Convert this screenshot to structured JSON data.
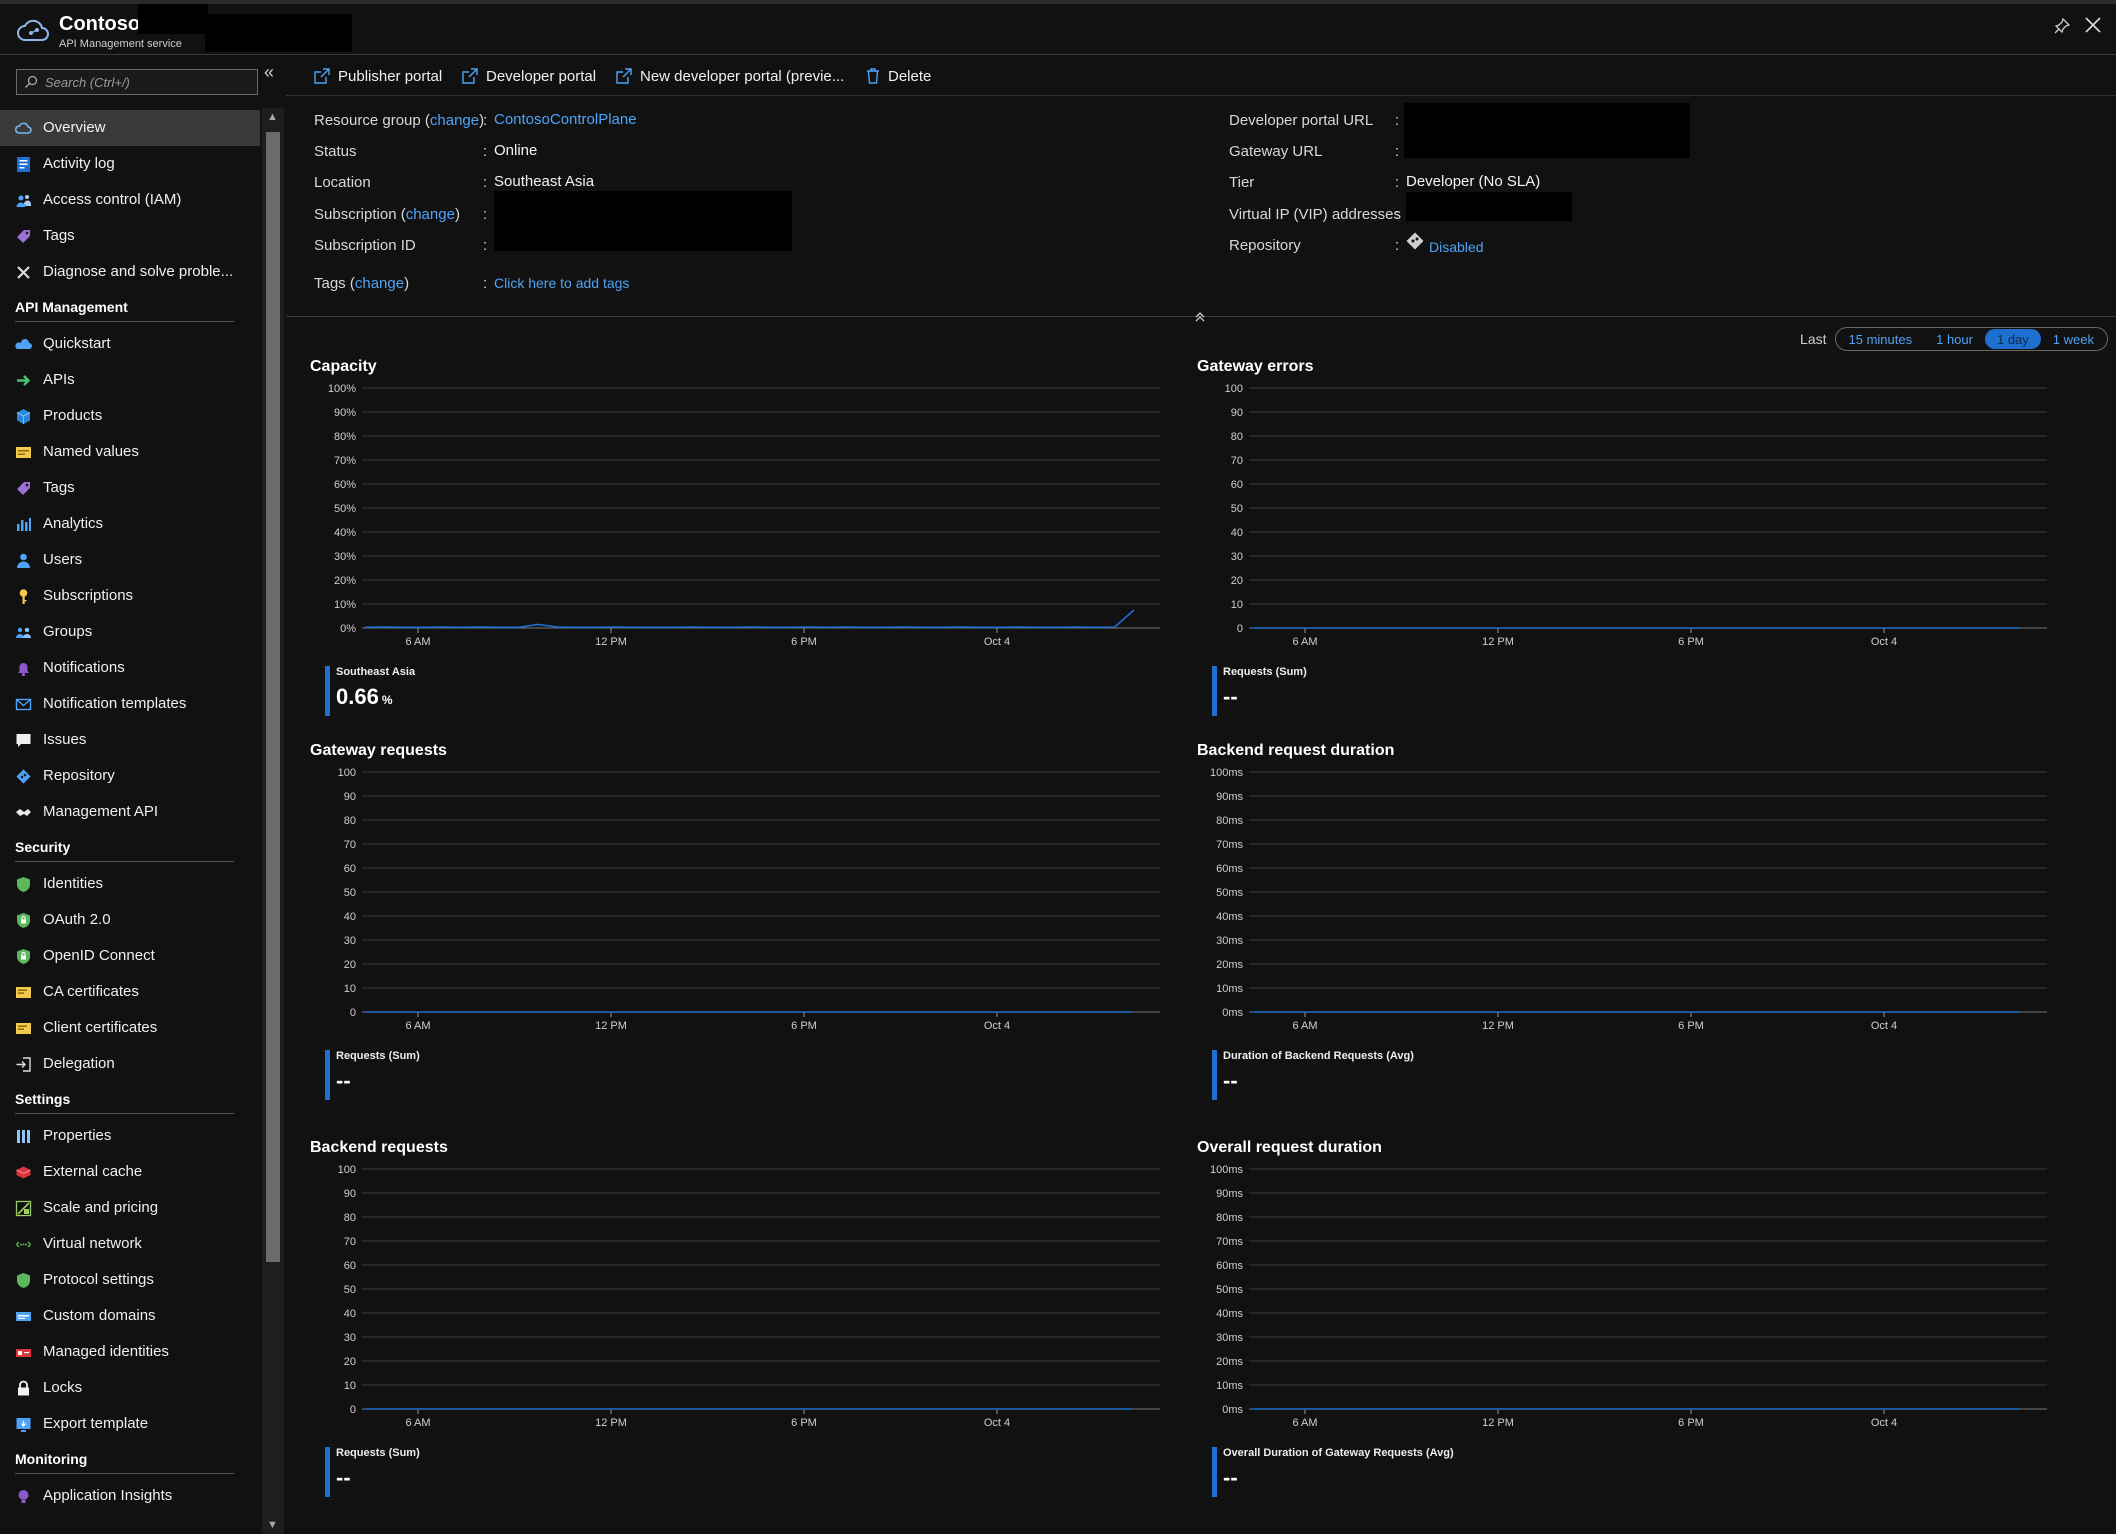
{
  "header": {
    "title": "Contoso",
    "subtitle": "API Management service"
  },
  "search": {
    "placeholder": "Search (Ctrl+/)"
  },
  "sidebar": {
    "collapse": "«",
    "entries": [
      {
        "kind": "item",
        "label": "Overview",
        "icon": "overview-cloud-icon",
        "active": true
      },
      {
        "kind": "item",
        "label": "Activity log",
        "icon": "activity-log-icon"
      },
      {
        "kind": "item",
        "label": "Access control (IAM)",
        "icon": "people-icon"
      },
      {
        "kind": "item",
        "label": "Tags",
        "icon": "tag-icon"
      },
      {
        "kind": "item",
        "label": "Diagnose and solve proble...",
        "icon": "wrench-icon"
      },
      {
        "kind": "section",
        "label": "API Management"
      },
      {
        "kind": "item",
        "label": "Quickstart",
        "icon": "cloud-icon"
      },
      {
        "kind": "item",
        "label": "APIs",
        "icon": "arrow-right-icon"
      },
      {
        "kind": "item",
        "label": "Products",
        "icon": "cube-icon"
      },
      {
        "kind": "item",
        "label": "Named values",
        "icon": "list-card-icon"
      },
      {
        "kind": "item",
        "label": "Tags",
        "icon": "tag-icon"
      },
      {
        "kind": "item",
        "label": "Analytics",
        "icon": "bar-chart-icon"
      },
      {
        "kind": "item",
        "label": "Users",
        "icon": "user-icon"
      },
      {
        "kind": "item",
        "label": "Subscriptions",
        "icon": "key-icon"
      },
      {
        "kind": "item",
        "label": "Groups",
        "icon": "group-icon"
      },
      {
        "kind": "item",
        "label": "Notifications",
        "icon": "bell-icon"
      },
      {
        "kind": "item",
        "label": "Notification templates",
        "icon": "mail-icon"
      },
      {
        "kind": "item",
        "label": "Issues",
        "icon": "chat-icon"
      },
      {
        "kind": "item",
        "label": "Repository",
        "icon": "repository-icon"
      },
      {
        "kind": "item",
        "label": "Management API",
        "icon": "handshake-icon"
      },
      {
        "kind": "section",
        "label": "Security"
      },
      {
        "kind": "item",
        "label": "Identities",
        "icon": "shield-icon"
      },
      {
        "kind": "item",
        "label": "OAuth 2.0",
        "icon": "shield-lock-icon"
      },
      {
        "kind": "item",
        "label": "OpenID Connect",
        "icon": "shield-lock-icon"
      },
      {
        "kind": "item",
        "label": "CA certificates",
        "icon": "certificate-icon"
      },
      {
        "kind": "item",
        "label": "Client certificates",
        "icon": "certificate-icon"
      },
      {
        "kind": "item",
        "label": "Delegation",
        "icon": "sign-in-icon"
      },
      {
        "kind": "section",
        "label": "Settings"
      },
      {
        "kind": "item",
        "label": "Properties",
        "icon": "properties-icon"
      },
      {
        "kind": "item",
        "label": "External cache",
        "icon": "cache-icon"
      },
      {
        "kind": "item",
        "label": "Scale and pricing",
        "icon": "scale-icon"
      },
      {
        "kind": "item",
        "label": "Virtual network",
        "icon": "network-icon"
      },
      {
        "kind": "item",
        "label": "Protocol settings",
        "icon": "shield-icon"
      },
      {
        "kind": "item",
        "label": "Custom domains",
        "icon": "domain-icon"
      },
      {
        "kind": "item",
        "label": "Managed identities",
        "icon": "identity-icon"
      },
      {
        "kind": "item",
        "label": "Locks",
        "icon": "lock-icon"
      },
      {
        "kind": "item",
        "label": "Export template",
        "icon": "export-icon"
      },
      {
        "kind": "section",
        "label": "Monitoring"
      },
      {
        "kind": "item",
        "label": "Application Insights",
        "icon": "insights-icon"
      }
    ]
  },
  "toolbar": {
    "publisher_portal": "Publisher portal",
    "developer_portal": "Developer portal",
    "new_developer_portal": "New developer portal (previe...",
    "delete": "Delete"
  },
  "essentials": {
    "resource_group_label": "Resource group",
    "change": "change",
    "resource_group_value": "ContosoControlPlane",
    "status_label": "Status",
    "status_value": "Online",
    "location_label": "Location",
    "location_value": "Southeast Asia",
    "subscription_label": "Subscription",
    "subscription_id_label": "Subscription ID",
    "tags_label": "Tags",
    "tags_value": "Click here to add tags",
    "dev_portal_url_label": "Developer portal URL",
    "gateway_url_label": "Gateway URL",
    "tier_label": "Tier",
    "tier_value": "Developer (No SLA)",
    "vip_label": "Virtual IP (VIP) addresses",
    "repository_label": "Repository",
    "repository_value": "Disabled",
    "colon": ":",
    "paren_open": "(",
    "paren_close": ")"
  },
  "time_range": {
    "last": "Last",
    "options": [
      "15 minutes",
      "1 hour",
      "1 day",
      "1 week"
    ],
    "selected": "1 day"
  },
  "chart_data": [
    {
      "type": "line",
      "title": "Capacity",
      "x_ticks": [
        "6 AM",
        "12 PM",
        "6 PM",
        "Oct 4"
      ],
      "y_ticks": [
        "0%",
        "10%",
        "20%",
        "30%",
        "40%",
        "50%",
        "60%",
        "70%",
        "80%",
        "90%",
        "100%"
      ],
      "ylim": [
        0,
        100
      ],
      "series": [
        {
          "name": "Southeast Asia",
          "values": [
            0.3,
            0.4,
            0.3,
            0.3,
            0.4,
            0.3,
            0.4,
            0.3,
            0.3,
            1.5,
            0.4,
            0.3,
            0.3,
            0.4,
            0.3,
            0.3,
            0.3,
            0.4,
            0.3,
            0.3,
            0.4,
            0.3,
            0.3,
            0.4,
            0.3,
            0.4,
            0.3,
            0.3,
            0.4,
            0.3,
            0.3,
            0.4,
            0.3,
            0.3,
            0.4,
            0.3,
            0.3,
            0.4,
            0.3,
            0.4,
            7.5
          ]
        }
      ],
      "legend_name": "Southeast Asia",
      "legend_value": "0.66",
      "legend_unit": "%",
      "line_color": "#1f6fd1"
    },
    {
      "type": "line",
      "title": "Gateway errors",
      "x_ticks": [
        "6 AM",
        "12 PM",
        "6 PM",
        "Oct 4"
      ],
      "y_ticks": [
        "0",
        "10",
        "20",
        "30",
        "40",
        "50",
        "60",
        "70",
        "80",
        "90",
        "100"
      ],
      "ylim": [
        0,
        100
      ],
      "series": [
        {
          "name": "Requests (Sum)",
          "values": [
            0,
            0
          ]
        }
      ],
      "legend_name": "Requests (Sum)",
      "legend_value": "--",
      "legend_unit": "",
      "line_color": "#1f6fd1"
    },
    {
      "type": "line",
      "title": "Gateway requests",
      "x_ticks": [
        "6 AM",
        "12 PM",
        "6 PM",
        "Oct 4"
      ],
      "y_ticks": [
        "0",
        "10",
        "20",
        "30",
        "40",
        "50",
        "60",
        "70",
        "80",
        "90",
        "100"
      ],
      "ylim": [
        0,
        100
      ],
      "series": [
        {
          "name": "Requests (Sum)",
          "values": [
            0,
            0
          ]
        }
      ],
      "legend_name": "Requests (Sum)",
      "legend_value": "--",
      "legend_unit": "",
      "line_color": "#1f6fd1"
    },
    {
      "type": "line",
      "title": "Backend request duration",
      "x_ticks": [
        "6 AM",
        "12 PM",
        "6 PM",
        "Oct 4"
      ],
      "y_ticks": [
        "0ms",
        "10ms",
        "20ms",
        "30ms",
        "40ms",
        "50ms",
        "60ms",
        "70ms",
        "80ms",
        "90ms",
        "100ms"
      ],
      "ylim": [
        0,
        100
      ],
      "series": [
        {
          "name": "Duration of Backend Requests (Avg)",
          "values": [
            0,
            0
          ]
        }
      ],
      "legend_name": "Duration of Backend Requests (Avg)",
      "legend_value": "--",
      "legend_unit": "",
      "line_color": "#1f6fd1"
    },
    {
      "type": "line",
      "title": "Backend requests",
      "x_ticks": [
        "6 AM",
        "12 PM",
        "6 PM",
        "Oct 4"
      ],
      "y_ticks": [
        "0",
        "10",
        "20",
        "30",
        "40",
        "50",
        "60",
        "70",
        "80",
        "90",
        "100"
      ],
      "ylim": [
        0,
        100
      ],
      "series": [
        {
          "name": "Requests (Sum)",
          "values": [
            0,
            0
          ]
        }
      ],
      "legend_name": "Requests (Sum)",
      "legend_value": "--",
      "legend_unit": "",
      "line_color": "#1f6fd1"
    },
    {
      "type": "line",
      "title": "Overall request duration",
      "x_ticks": [
        "6 AM",
        "12 PM",
        "6 PM",
        "Oct 4"
      ],
      "y_ticks": [
        "0ms",
        "10ms",
        "20ms",
        "30ms",
        "40ms",
        "50ms",
        "60ms",
        "70ms",
        "80ms",
        "90ms",
        "100ms"
      ],
      "ylim": [
        0,
        100
      ],
      "series": [
        {
          "name": "Overall Duration of Gateway Requests (Avg)",
          "values": [
            0,
            0
          ]
        }
      ],
      "legend_name": "Overall Duration of Gateway Requests (Avg)",
      "legend_value": "--",
      "legend_unit": "",
      "line_color": "#1f6fd1"
    }
  ],
  "colors": {
    "accent": "#4fa3f7",
    "series": "#1f6fd1",
    "background": "#111111"
  }
}
